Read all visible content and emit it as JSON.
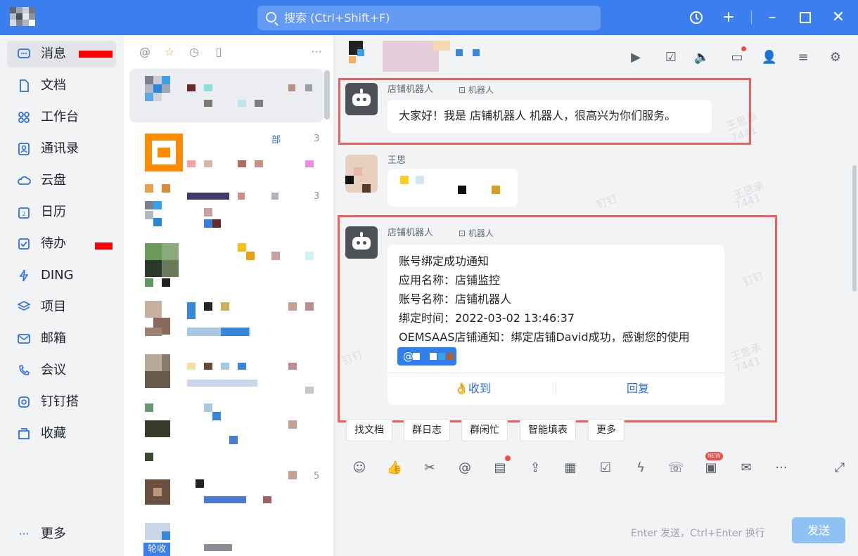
{
  "titlebar": {
    "search_placeholder": "搜索 (Ctrl+Shift+F)",
    "history_icon": "history-icon",
    "add_icon": "add-icon"
  },
  "nav": {
    "items": [
      {
        "label": "消息",
        "icon": "message-icon",
        "active": true
      },
      {
        "label": "文档",
        "icon": "document-icon"
      },
      {
        "label": "工作台",
        "icon": "workbench-icon"
      },
      {
        "label": "通讯录",
        "icon": "contacts-icon"
      },
      {
        "label": "云盘",
        "icon": "cloud-drive-icon"
      },
      {
        "label": "日历",
        "icon": "calendar-icon"
      },
      {
        "label": "待办",
        "icon": "todo-icon"
      },
      {
        "label": "DING",
        "icon": "ding-icon"
      },
      {
        "label": "项目",
        "icon": "project-icon"
      },
      {
        "label": "邮箱",
        "icon": "mail-icon"
      },
      {
        "label": "会议",
        "icon": "meeting-icon"
      },
      {
        "label": "钉钉搭",
        "icon": "dingda-icon"
      },
      {
        "label": "收藏",
        "icon": "favorite-icon"
      }
    ],
    "more_label": "更多"
  },
  "chatlist": {
    "partial_texts": [
      "部",
      "3",
      "3",
      "5"
    ],
    "bottom_badge": "轮收"
  },
  "messages": {
    "bot_name": "店铺机器人",
    "bot_tag": "机器人",
    "msg1_text": "大家好！我是 店铺机器人 机器人，很高兴为你们服务。",
    "other_sender": "王思",
    "card_lines": [
      "账号绑定成功通知",
      "应用名称：店铺监控",
      "账号名称：店铺机器人",
      "绑定时间：2022-03-02 13:46:37",
      "OEMSAAS店铺通知：绑定店铺David成功，感谢您的使用"
    ],
    "at_label": "@",
    "received_label": "收到",
    "reply_label": "回复"
  },
  "quick_actions": [
    "找文档",
    "群日志",
    "群闲忙",
    "智能填表",
    "更多"
  ],
  "composer": {
    "new_badge": "NEW",
    "hint": "Enter 发送，Ctrl+Enter 换行",
    "send_label": "发送"
  },
  "watermark": {
    "name": "王思承",
    "id": "7441",
    "brand": "钉钉"
  },
  "colors": {
    "accent": "#3a7ef0",
    "highlight_box": "#f0605a"
  }
}
